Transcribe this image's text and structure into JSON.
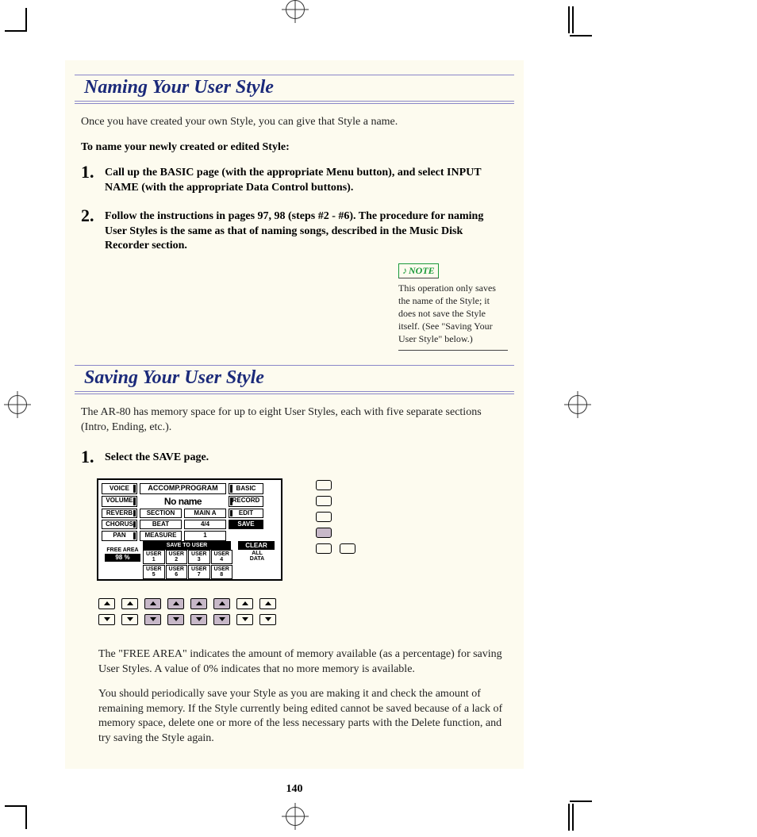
{
  "section1": {
    "title": "Naming Your User Style",
    "intro": "Once you have created your own Style, you can give that Style a name.",
    "lead": "To name your newly created or edited Style:",
    "steps": [
      {
        "num": "1.",
        "text": "Call up the BASIC page (with the appropriate Menu button), and select INPUT NAME (with the appropriate Data Control buttons)."
      },
      {
        "num": "2.",
        "text": "Follow the instructions in pages 97, 98 (steps #2 - #6).  The procedure for naming User Styles is the same as that of naming songs, described in the Music Disk Recorder section."
      }
    ],
    "note": {
      "label": "NOTE",
      "text": "This operation only saves the name of the Style; it does not save the Style itself.  (See \"Saving Your User Style\" below.)"
    }
  },
  "section2": {
    "title": "Saving Your User Style",
    "intro": "The AR-80 has memory space for up to eight User Styles, each with five separate sections (Intro, Ending, etc.).",
    "step1": {
      "num": "1.",
      "text": "Select the SAVE page."
    },
    "lcd": {
      "left": [
        "VOICE",
        "VOLUME",
        "REVERB",
        "CHORUS",
        "PAN"
      ],
      "heading": "ACCOMP.PROGRAM",
      "title": "No name",
      "mid_rows": [
        {
          "l": "SECTION",
          "r": "MAIN A"
        },
        {
          "l": "BEAT",
          "r": "4/4"
        },
        {
          "l": "MEASURE",
          "r": "1"
        }
      ],
      "right": [
        "BASIC",
        "RECORD",
        "EDIT",
        "SAVE"
      ],
      "save_to": "SAVE TO USER",
      "clear": "CLEAR",
      "all_data": "ALL\nDATA",
      "free_area_label": "FREE AREA",
      "free_area_value": "98 %",
      "users_top": [
        "USER\n1",
        "USER\n2",
        "USER\n3",
        "USER\n4"
      ],
      "users_bot": [
        "USER\n5",
        "USER\n6",
        "USER\n7",
        "USER\n8"
      ]
    },
    "para_free": "The \"FREE AREA\" indicates the amount of memory available (as a percentage) for saving User Styles.  A value of 0% indicates that no more memory is available.",
    "para_save": "You should periodically save your Style as you are making it and check the amount of remaining memory.  If the Style currently being edited cannot be saved because of a lack of memory space, delete one or more of the less necessary parts with the Delete function, and try saving the Style again."
  },
  "pagenum": "140"
}
